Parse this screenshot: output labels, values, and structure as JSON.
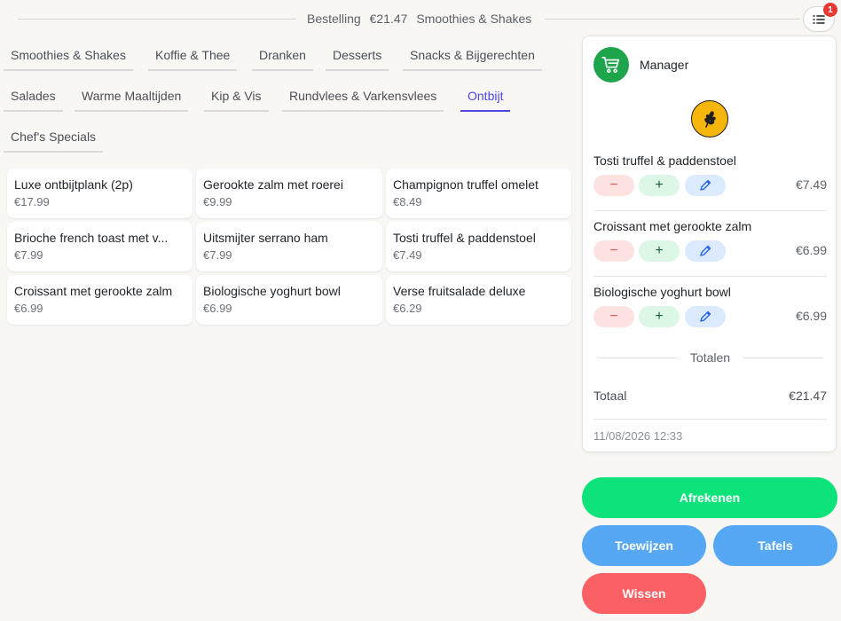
{
  "header": {
    "order_label": "Bestelling",
    "order_total": "€21.47",
    "current_category": "Smoothies & Shakes",
    "badge_count": "1"
  },
  "categories": [
    {
      "label": "Smoothies & Shakes"
    },
    {
      "label": "Koffie & Thee"
    },
    {
      "label": "Dranken"
    },
    {
      "label": "Desserts"
    },
    {
      "label": "Snacks & Bijgerechten"
    },
    {
      "label": "Salades"
    },
    {
      "label": "Warme Maaltijden"
    },
    {
      "label": "Kip & Vis"
    },
    {
      "label": "Rundvlees & Varkensvlees"
    },
    {
      "label": "Ontbijt"
    },
    {
      "label": "Chef's Specials"
    }
  ],
  "products": [
    {
      "name": "Luxe ontbijtplank (2p)",
      "price": "€17.99"
    },
    {
      "name": "Gerookte zalm met roerei",
      "price": "€9.99"
    },
    {
      "name": "Champignon truffel omelet",
      "price": "€8.49"
    },
    {
      "name": "Brioche french toast met v...",
      "price": "€7.99"
    },
    {
      "name": "Uitsmijter serrano ham",
      "price": "€7.99"
    },
    {
      "name": "Tosti truffel & paddenstoel",
      "price": "€7.49"
    },
    {
      "name": "Croissant met gerookte zalm",
      "price": "€6.99"
    },
    {
      "name": "Biologische yoghurt bowl",
      "price": "€6.99"
    },
    {
      "name": "Verse fruitsalade deluxe",
      "price": "€6.29"
    }
  ],
  "order": {
    "user": "Manager",
    "items": [
      {
        "name": "Tosti truffel & paddenstoel",
        "price": "€7.49",
        "minus": "−",
        "plus": "+"
      },
      {
        "name": "Croissant met gerookte zalm",
        "price": "€6.99",
        "minus": "−",
        "plus": "+"
      },
      {
        "name": "Biologische yoghurt bowl",
        "price": "€6.99",
        "minus": "−",
        "plus": "+"
      }
    ],
    "totals_label": "Totalen",
    "total_label": "Totaal",
    "total_value": "€21.47",
    "timestamp": "11/08/2026 12:33"
  },
  "actions": {
    "pay": "Afrekenen",
    "assign": "Toewijzen",
    "tables": "Tafels",
    "clear": "Wissen"
  },
  "colors": {
    "accent": "#4f46e5",
    "pay": "#0ee27a",
    "secondary": "#56a8f5",
    "danger": "#fb6164",
    "cart": "#1ea44b"
  }
}
